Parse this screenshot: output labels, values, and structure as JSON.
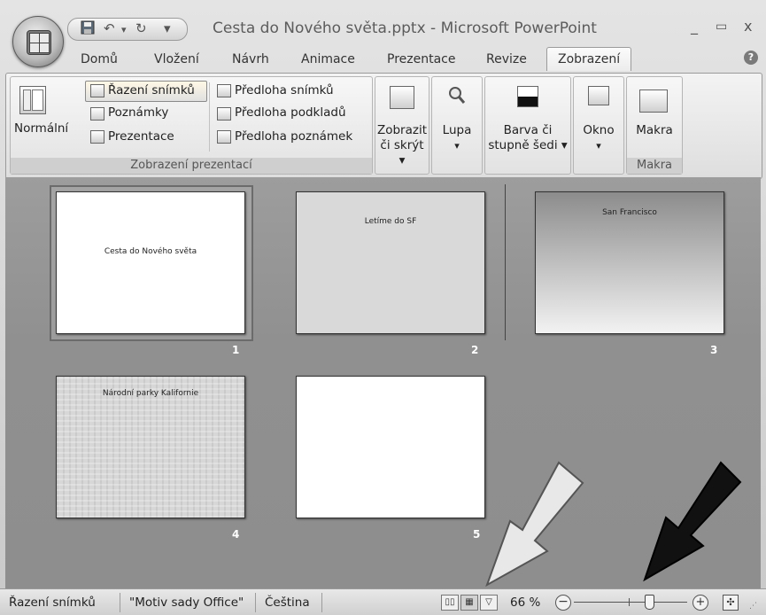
{
  "window": {
    "title": "Cesta do Nového světa.pptx - Microsoft PowerPoint",
    "minimize_glyph": "_",
    "maximize_glyph": "▭",
    "close_glyph": "x"
  },
  "quick_access": {
    "save_icon": "save-icon",
    "undo_glyph": "↶",
    "redo_glyph": "↻",
    "customize_glyph": "▾"
  },
  "tabs": [
    {
      "label": "Domů"
    },
    {
      "label": "Vložení"
    },
    {
      "label": "Návrh"
    },
    {
      "label": "Animace"
    },
    {
      "label": "Prezentace"
    },
    {
      "label": "Revize"
    },
    {
      "label": "Zobrazení",
      "active": true
    }
  ],
  "help_glyph": "?",
  "ribbon": {
    "presentation_views": {
      "label": "Zobrazení prezentací",
      "normal": "Normální",
      "slide_sorter": "Řazení snímků",
      "notes": "Poznámky",
      "slideshow": "Prezentace",
      "slide_master": "Předloha snímků",
      "handout_master": "Předloha podkladů",
      "notes_master": "Předloha poznámek"
    },
    "show_hide": {
      "line1": "Zobrazit",
      "line2": "či skrýt ▾"
    },
    "zoom": {
      "line1": "Lupa",
      "line2": "▾"
    },
    "color": {
      "line1": "Barva či",
      "line2": "stupně šedi ▾"
    },
    "window_btn": {
      "line1": "Okno",
      "line2": "▾"
    },
    "macros": {
      "button": "Makra",
      "label": "Makra"
    }
  },
  "slides": [
    {
      "number": "1",
      "title": "Cesta do Nového světa",
      "background": "white",
      "selected": true
    },
    {
      "number": "2",
      "title": "Letíme do SF",
      "background": "lightgray"
    },
    {
      "number": "3",
      "title": "San Francisco",
      "background": "gradient"
    },
    {
      "number": "4",
      "title": "Národní parky Kalifornie",
      "background": "texture"
    },
    {
      "number": "5",
      "title": "",
      "background": "white"
    }
  ],
  "status_bar": {
    "view": "Řazení snímků",
    "theme": "\"Motiv sady Office\"",
    "language": "Čeština",
    "zoom": "66 %"
  },
  "annotations": {
    "light_arrow": "white-arrow-pointing-to-slideshow-button",
    "dark_arrow": "black-arrow-pointing-to-zoom-slider"
  }
}
